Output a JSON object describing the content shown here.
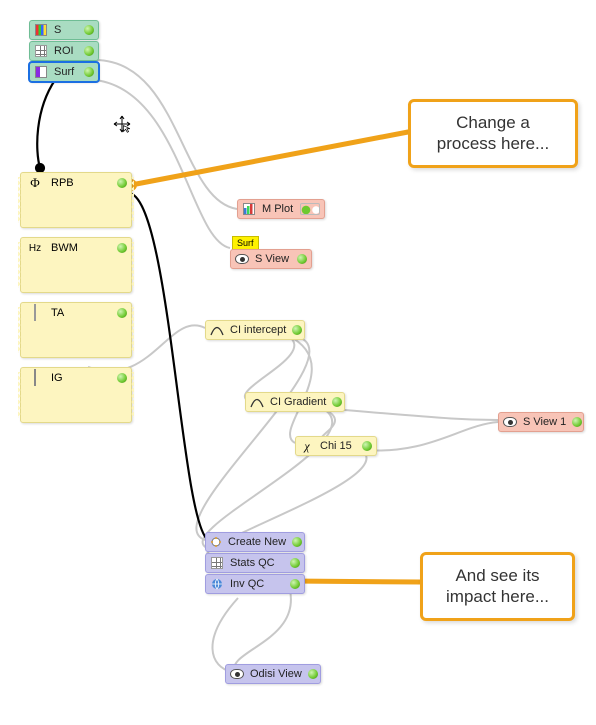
{
  "top_stack": {
    "s": {
      "label": "S"
    },
    "roi": {
      "label": "ROI"
    },
    "surf": {
      "label": "Surf"
    }
  },
  "process_nodes": {
    "rpb": {
      "symbol": "Φ",
      "label": "RPB"
    },
    "bwm": {
      "symbol": "Hz",
      "label": "BWM"
    },
    "ta": {
      "symbol": "",
      "label": "TA"
    },
    "ig": {
      "symbol": "",
      "label": "IG"
    }
  },
  "mid_nodes": {
    "mplot": {
      "label": "M Plot"
    },
    "sview": {
      "label": "S View",
      "sticky": "Surf"
    },
    "ci_intercept": {
      "label": "CI intercept"
    },
    "ci_gradient": {
      "label": "CI Gradient"
    },
    "chi15": {
      "symbol": "χ",
      "label": "Chi 15"
    },
    "sview1": {
      "label": "S View 1"
    }
  },
  "bottom_stack": {
    "create_new": {
      "label": "Create New"
    },
    "stats_qc": {
      "label": "Stats QC"
    },
    "inv_qc": {
      "label": "Inv QC"
    },
    "odisi_view": {
      "label": "Odisi View"
    }
  },
  "callouts": {
    "top": {
      "line1": "Change a",
      "line2": "process here..."
    },
    "bottom": {
      "line1": "And see its",
      "line2": "impact here..."
    }
  },
  "colors": {
    "callout_border": "#f0a219",
    "node_green": "#a9dcc2",
    "node_yellow": "#fdf5c0",
    "node_salmon": "#f8c4b7",
    "node_lav": "#c6c4ed",
    "status_dot": "#6ec92f"
  }
}
